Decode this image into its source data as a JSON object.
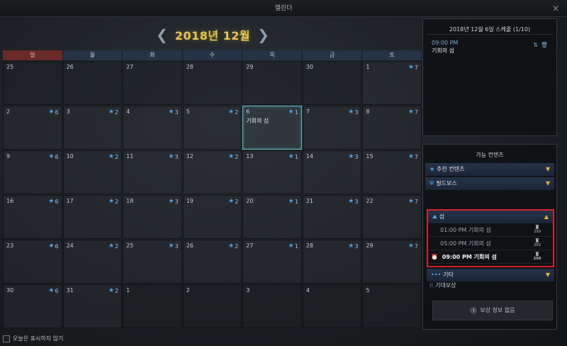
{
  "window": {
    "title": "캘린더",
    "close_symbol": "✕"
  },
  "month_nav": {
    "prev": "❮",
    "label": "2018년 12월",
    "next": "❯"
  },
  "weekdays": [
    "일",
    "월",
    "화",
    "수",
    "목",
    "금",
    "토"
  ],
  "days": [
    {
      "d": "25",
      "b": ""
    },
    {
      "d": "26",
      "b": ""
    },
    {
      "d": "27",
      "b": ""
    },
    {
      "d": "28",
      "b": ""
    },
    {
      "d": "29",
      "b": ""
    },
    {
      "d": "30",
      "b": ""
    },
    {
      "d": "1",
      "b": "7"
    },
    {
      "d": "2",
      "b": "6"
    },
    {
      "d": "3",
      "b": "2"
    },
    {
      "d": "4",
      "b": "3"
    },
    {
      "d": "5",
      "b": "2"
    },
    {
      "d": "6",
      "b": "1",
      "event": "기회의 섬"
    },
    {
      "d": "7",
      "b": "3"
    },
    {
      "d": "8",
      "b": "7"
    },
    {
      "d": "9",
      "b": "6"
    },
    {
      "d": "10",
      "b": "2"
    },
    {
      "d": "11",
      "b": "3"
    },
    {
      "d": "12",
      "b": "2"
    },
    {
      "d": "13",
      "b": "1"
    },
    {
      "d": "14",
      "b": "3"
    },
    {
      "d": "15",
      "b": "7"
    },
    {
      "d": "16",
      "b": "6"
    },
    {
      "d": "17",
      "b": "2"
    },
    {
      "d": "18",
      "b": "3"
    },
    {
      "d": "19",
      "b": "2"
    },
    {
      "d": "20",
      "b": "1"
    },
    {
      "d": "21",
      "b": "3"
    },
    {
      "d": "22",
      "b": "7"
    },
    {
      "d": "23",
      "b": "6"
    },
    {
      "d": "24",
      "b": "2"
    },
    {
      "d": "25",
      "b": "3"
    },
    {
      "d": "26",
      "b": "2"
    },
    {
      "d": "27",
      "b": "1"
    },
    {
      "d": "28",
      "b": "3"
    },
    {
      "d": "29",
      "b": "7"
    },
    {
      "d": "30",
      "b": "6"
    },
    {
      "d": "31",
      "b": "2"
    },
    {
      "d": "1",
      "b": ""
    },
    {
      "d": "2",
      "b": ""
    },
    {
      "d": "3",
      "b": ""
    },
    {
      "d": "4",
      "b": ""
    },
    {
      "d": "5",
      "b": ""
    }
  ],
  "schedule": {
    "header": "2018년 12월 6일 스케줄 (1/10)",
    "items": [
      {
        "time": "09:00 PM",
        "title": "기회의 섬"
      }
    ]
  },
  "content_panel": {
    "header": "가능 컨텐츠",
    "categories": {
      "recommended": "추천 컨텐츠",
      "field_boss": "필드보스",
      "island": "섬",
      "etc": "기타"
    },
    "island_items": [
      {
        "time": "01:00 PM",
        "title": "기회의 섬",
        "reward_count": "250"
      },
      {
        "time": "05:00 PM",
        "title": "기회의 섬",
        "reward_count": "250"
      },
      {
        "time": "09:00 PM",
        "title": "기회의 섬",
        "reward_count": "250"
      }
    ]
  },
  "expected_reward": {
    "label": "기대보상",
    "empty_text": "보상 정보 없음"
  },
  "footer": {
    "dont_show_today": "오늘은 표시하지 않기"
  }
}
